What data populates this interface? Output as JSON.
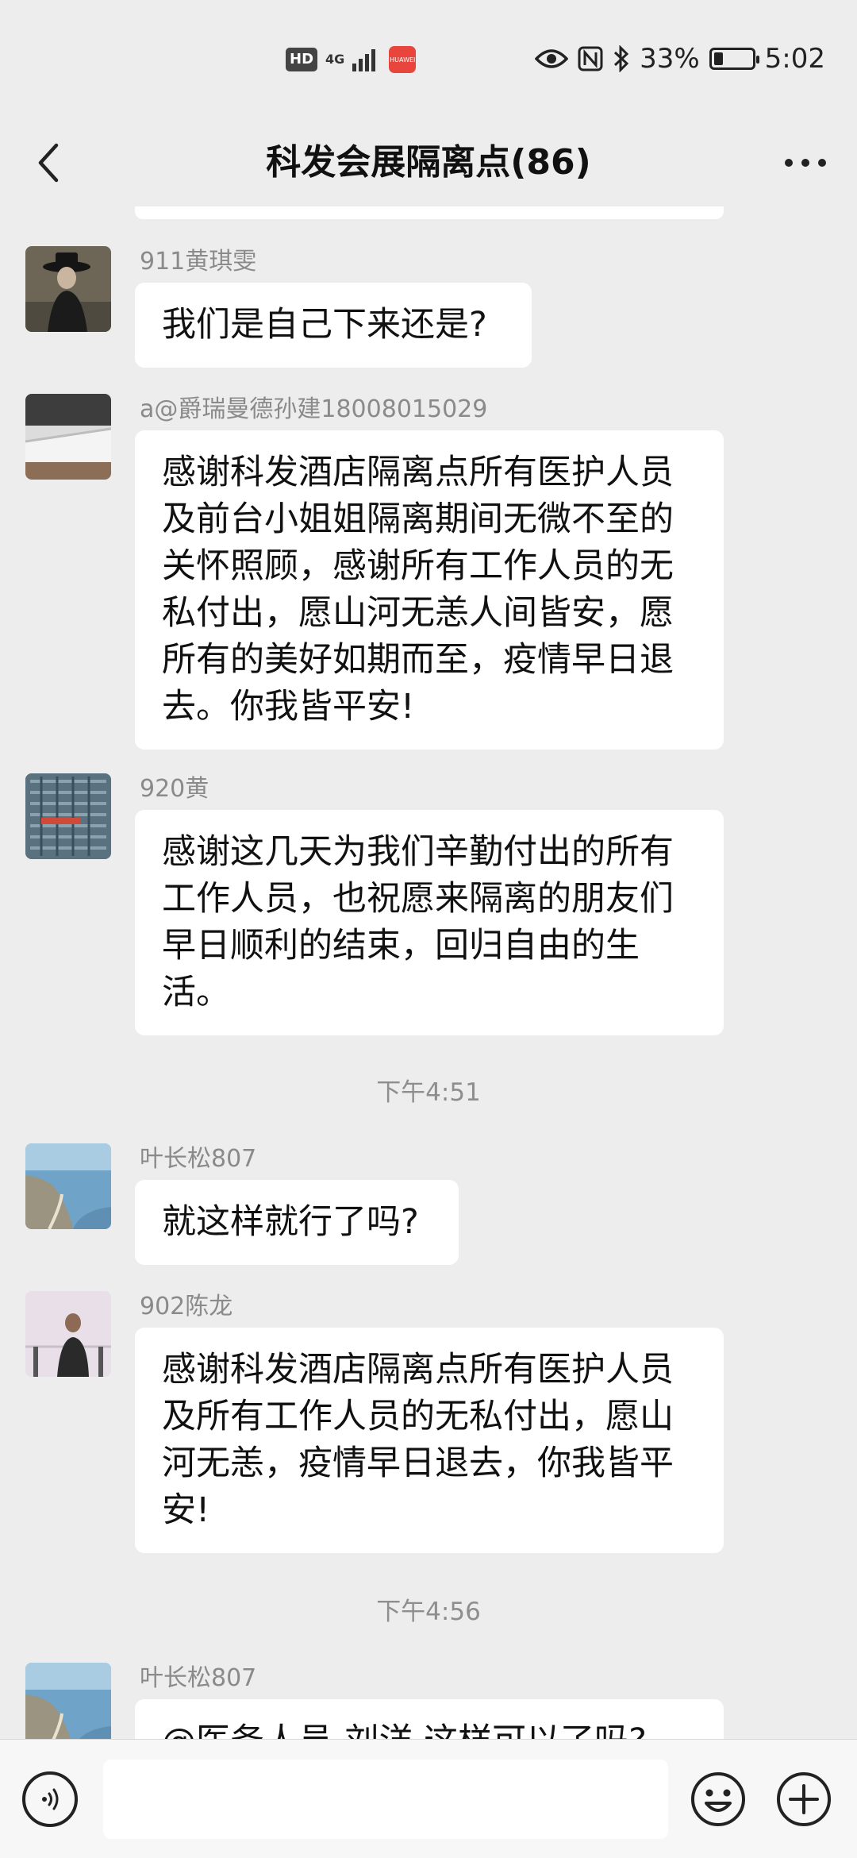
{
  "status_bar": {
    "hd": "HD",
    "network": "4G",
    "app_icon_label": "HUAWEI",
    "battery_percent": "33%",
    "battery_level": 0.33,
    "time": "5:02",
    "icons": [
      "eye-icon",
      "nfc-icon",
      "bluetooth-icon",
      "battery-icon"
    ]
  },
  "header": {
    "title": "科发会展隔离点(86)",
    "back_icon": "chevron-left-icon",
    "more_icon": "more-icon"
  },
  "messages": [
    {
      "sender": "911黄琪雯",
      "text": "我们是自己下来还是?"
    },
    {
      "sender": "a@爵瑞曼德孙建18008015029",
      "text": "感谢科发酒店隔离点所有医护人员及前台小姐姐隔离期间无微不至的关怀照顾，感谢所有工作人员的无私付出，愿山河无恙人间皆安，愿所有的美好如期而至，疫情早日退去。你我皆平安!"
    },
    {
      "sender": "920黄",
      "text": "感谢这几天为我们辛勤付出的所有工作人员，也祝愿来隔离的朋友们早日顺利的结束，回归自由的生活。"
    },
    {
      "sender": "叶长松807",
      "text": "就这样就行了吗?"
    },
    {
      "sender": "902陈龙",
      "text": "感谢科发酒店隔离点所有医护人员及所有工作人员的无私付出，愿山河无恙，疫情早日退去，你我皆平安!"
    },
    {
      "sender": "叶长松807",
      "text": "@医务人员-刘洋 这样可以了吗?"
    }
  ],
  "timestamps": [
    "下午4:51",
    "下午4:56"
  ],
  "input_bar": {
    "placeholder": "",
    "voice_icon": "voice-icon",
    "emoji_icon": "emoji-icon",
    "plus_icon": "plus-icon"
  }
}
